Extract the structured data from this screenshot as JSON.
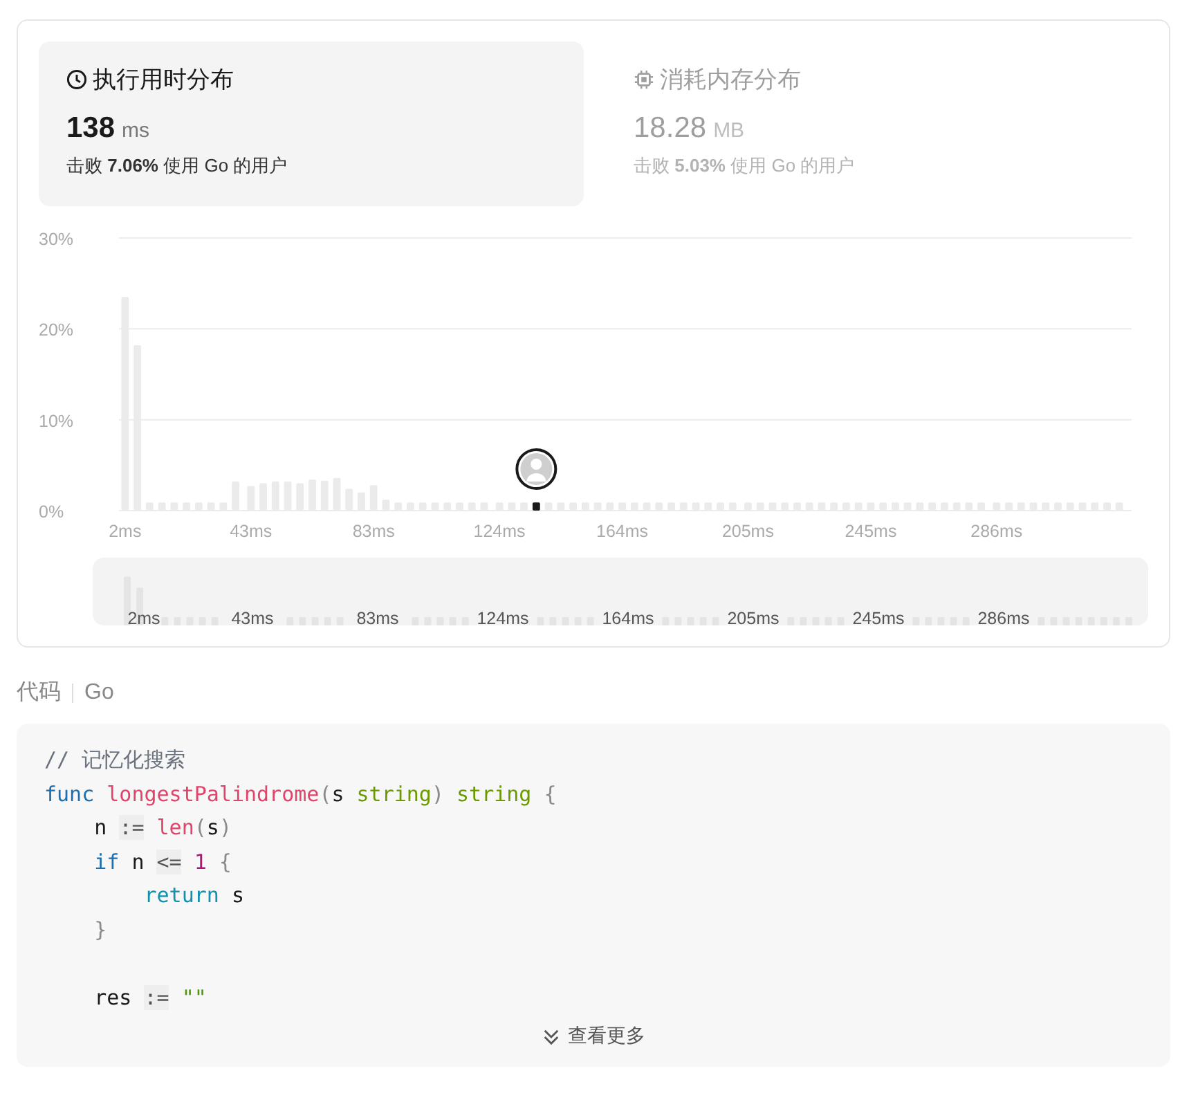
{
  "tabs": [
    {
      "kind": "time",
      "title": "执行用时分布",
      "value": "138",
      "unit": "ms",
      "beat_prefix": "击败",
      "beat_value": "7.06%",
      "beat_suffix": "使用 Go 的用户",
      "selected": true
    },
    {
      "kind": "memory",
      "title": "消耗内存分布",
      "value": "18.28",
      "unit": "MB",
      "beat_prefix": "击败",
      "beat_value": "5.03%",
      "beat_suffix": "使用 Go 的用户",
      "selected": false
    }
  ],
  "chart": {
    "chart_data": {
      "type": "bar",
      "xlim": [
        0,
        330
      ],
      "ylim": [
        0,
        30
      ],
      "yticks": [
        {
          "value": 0,
          "label": "0%"
        },
        {
          "value": 10,
          "label": "10%"
        },
        {
          "value": 20,
          "label": "20%"
        },
        {
          "value": 30,
          "label": "30%"
        }
      ],
      "x": [
        2,
        6,
        10,
        14,
        18,
        22,
        26,
        30,
        34,
        38,
        43,
        47,
        51,
        55,
        59,
        63,
        67,
        71,
        75,
        79,
        83,
        87,
        91,
        95,
        99,
        103,
        107,
        111,
        115,
        119,
        124,
        128,
        132,
        136,
        140,
        144,
        148,
        152,
        156,
        160,
        164,
        168,
        172,
        176,
        180,
        184,
        188,
        192,
        196,
        200,
        205,
        209,
        213,
        217,
        221,
        225,
        229,
        233,
        237,
        241,
        245,
        249,
        253,
        257,
        261,
        265,
        269,
        273,
        277,
        281,
        286,
        290,
        294,
        298,
        302,
        306,
        310,
        314,
        318,
        322,
        326
      ],
      "xticks": [
        {
          "value": 2,
          "label": "2ms"
        },
        {
          "value": 43,
          "label": "43ms"
        },
        {
          "value": 83,
          "label": "83ms"
        },
        {
          "value": 124,
          "label": "124ms"
        },
        {
          "value": 164,
          "label": "164ms"
        },
        {
          "value": 205,
          "label": "205ms"
        },
        {
          "value": 245,
          "label": "245ms"
        },
        {
          "value": 286,
          "label": "286ms"
        }
      ],
      "series": [
        {
          "color": "#ebebeb",
          "values": [
            23.5,
            18.2,
            0.9,
            0.9,
            0.9,
            0.9,
            0.9,
            0.9,
            0.9,
            3.2,
            2.7,
            3.0,
            3.2,
            3.2,
            3.0,
            3.4,
            3.3,
            3.6,
            2.4,
            2.0,
            2.8,
            1.2,
            0.9,
            0.9,
            0.9,
            0.9,
            0.9,
            0.9,
            0.9,
            0.9,
            0.9,
            0.9,
            0.9,
            null,
            0.9,
            0.9,
            0.9,
            0.9,
            0.9,
            0.9,
            0.9,
            0.9,
            0.9,
            0.9,
            0.9,
            0.9,
            0.9,
            0.9,
            0.9,
            0.9,
            0.9,
            0.9,
            0.9,
            0.9,
            0.9,
            0.9,
            0.9,
            0.9,
            0.9,
            0.9,
            0.9,
            0.9,
            0.9,
            0.9,
            0.9,
            0.9,
            0.9,
            0.9,
            0.9,
            0.9,
            0.9,
            0.9,
            0.9,
            0.9,
            0.9,
            0.9,
            0.9,
            0.9,
            0.9,
            0.9,
            0.9
          ]
        },
        {
          "color": "#1a1a1a",
          "values": [
            null,
            null,
            null,
            null,
            null,
            null,
            null,
            null,
            null,
            null,
            null,
            null,
            null,
            null,
            null,
            null,
            null,
            null,
            null,
            null,
            null,
            null,
            null,
            null,
            null,
            null,
            null,
            null,
            null,
            null,
            null,
            null,
            null,
            0.9,
            null,
            null,
            null,
            null,
            null,
            null,
            null,
            null,
            null,
            null,
            null,
            null,
            null,
            null,
            null,
            null,
            null,
            null,
            null,
            null,
            null,
            null,
            null,
            null,
            null,
            null,
            null,
            null,
            null,
            null,
            null,
            null,
            null,
            null,
            null,
            null,
            null,
            null,
            null,
            null,
            null,
            null,
            null,
            null,
            null,
            null,
            null
          ]
        }
      ]
    },
    "overview": {
      "labels": [
        "2ms",
        "43ms",
        "83ms",
        "124ms",
        "164ms",
        "205ms",
        "245ms",
        "286ms"
      ]
    }
  },
  "code": {
    "heading": "代码",
    "language": "Go",
    "more": "查看更多",
    "lines": [
      {
        "kind": "code",
        "tokens": [
          {
            "text": "// 记忆化搜索",
            "kind": "comment"
          }
        ]
      },
      {
        "kind": "code",
        "tokens": [
          {
            "text": "func ",
            "kind": "keyword"
          },
          {
            "text": "longestPalindrome",
            "kind": "func"
          },
          {
            "text": "(",
            "kind": "punct"
          },
          {
            "text": "s ",
            "kind": "plain"
          },
          {
            "text": "string",
            "kind": "type"
          },
          {
            "text": ") ",
            "kind": "punct"
          },
          {
            "text": "string",
            "kind": "type"
          },
          {
            "text": " {",
            "kind": "punct"
          }
        ]
      },
      {
        "kind": "code",
        "tokens": [
          {
            "text": "    n ",
            "kind": "plain"
          },
          {
            "text": ":=",
            "kind": "op"
          },
          {
            "text": " len",
            "kind": "func"
          },
          {
            "text": "(",
            "kind": "punct"
          },
          {
            "text": "s",
            "kind": "plain"
          },
          {
            "text": ")",
            "kind": "punct"
          }
        ]
      },
      {
        "kind": "code",
        "tokens": [
          {
            "text": "    if",
            "kind": "keyword"
          },
          {
            "text": " n ",
            "kind": "plain"
          },
          {
            "text": "<=",
            "kind": "op"
          },
          {
            "text": " 1",
            "kind": "number"
          },
          {
            "text": " {",
            "kind": "punct"
          }
        ]
      },
      {
        "kind": "code",
        "tokens": [
          {
            "text": "        return",
            "kind": "control"
          },
          {
            "text": " s",
            "kind": "plain"
          }
        ]
      },
      {
        "kind": "code",
        "tokens": [
          {
            "text": "    }",
            "kind": "punct"
          }
        ]
      },
      {
        "kind": "blank"
      },
      {
        "kind": "code",
        "tokens": [
          {
            "text": "    res ",
            "kind": "plain"
          },
          {
            "text": ":=",
            "kind": "op"
          },
          {
            "text": " \"\"",
            "kind": "string"
          }
        ]
      }
    ]
  }
}
